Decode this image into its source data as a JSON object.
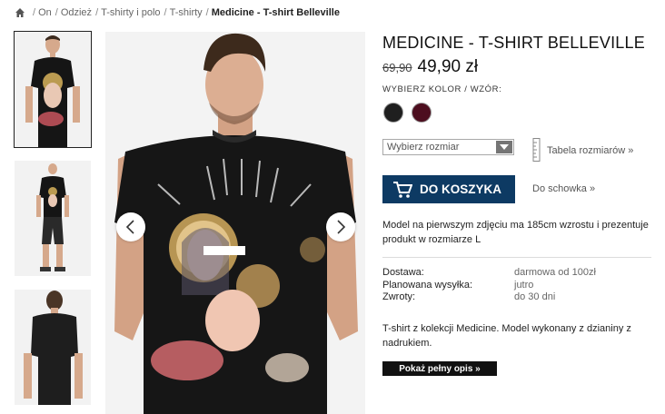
{
  "breadcrumb": {
    "home_icon": "home-icon",
    "items": [
      "On",
      "Odzież",
      "T-shirty i polo",
      "T-shirty"
    ],
    "current": "Medicine - T-shirt Belleville"
  },
  "gallery": {
    "prev_icon": "chevron-left-icon",
    "next_icon": "chevron-right-icon"
  },
  "product": {
    "title": "MEDICINE - T-SHIRT BELLEVILLE",
    "old_price": "69,90",
    "new_price": "49,90 zł",
    "color_label": "WYBIERZ KOLOR / WZÓR:",
    "colors": [
      "#1f1f1f",
      "#4d0e1f"
    ],
    "size_select": "Wybierz rozmiar",
    "size_table_link": "Tabela rozmiarów »",
    "add_to_cart": "DO KOSZYKA",
    "wishlist_link": "Do schowka »",
    "model_note": "Model na pierwszym zdjęciu ma 185cm wzrostu i prezentuje produkt w rozmiarze L",
    "info": [
      {
        "label": "Dostawa:",
        "value": "darmowa od 100zł"
      },
      {
        "label": "Planowana wysyłka:",
        "value": "jutro"
      },
      {
        "label": "Zwroty:",
        "value": "do 30 dni"
      }
    ],
    "description": "T-shirt z kolekcji Medicine. Model wykonany z dzianiny z nadrukiem.",
    "full_description_button": "Pokaż pełny opis »"
  },
  "colors": {
    "accent": "#0d3a63",
    "black_button": "#111111",
    "swatch_black": "#1f1f1f",
    "swatch_burgundy": "#4d0e1f"
  }
}
